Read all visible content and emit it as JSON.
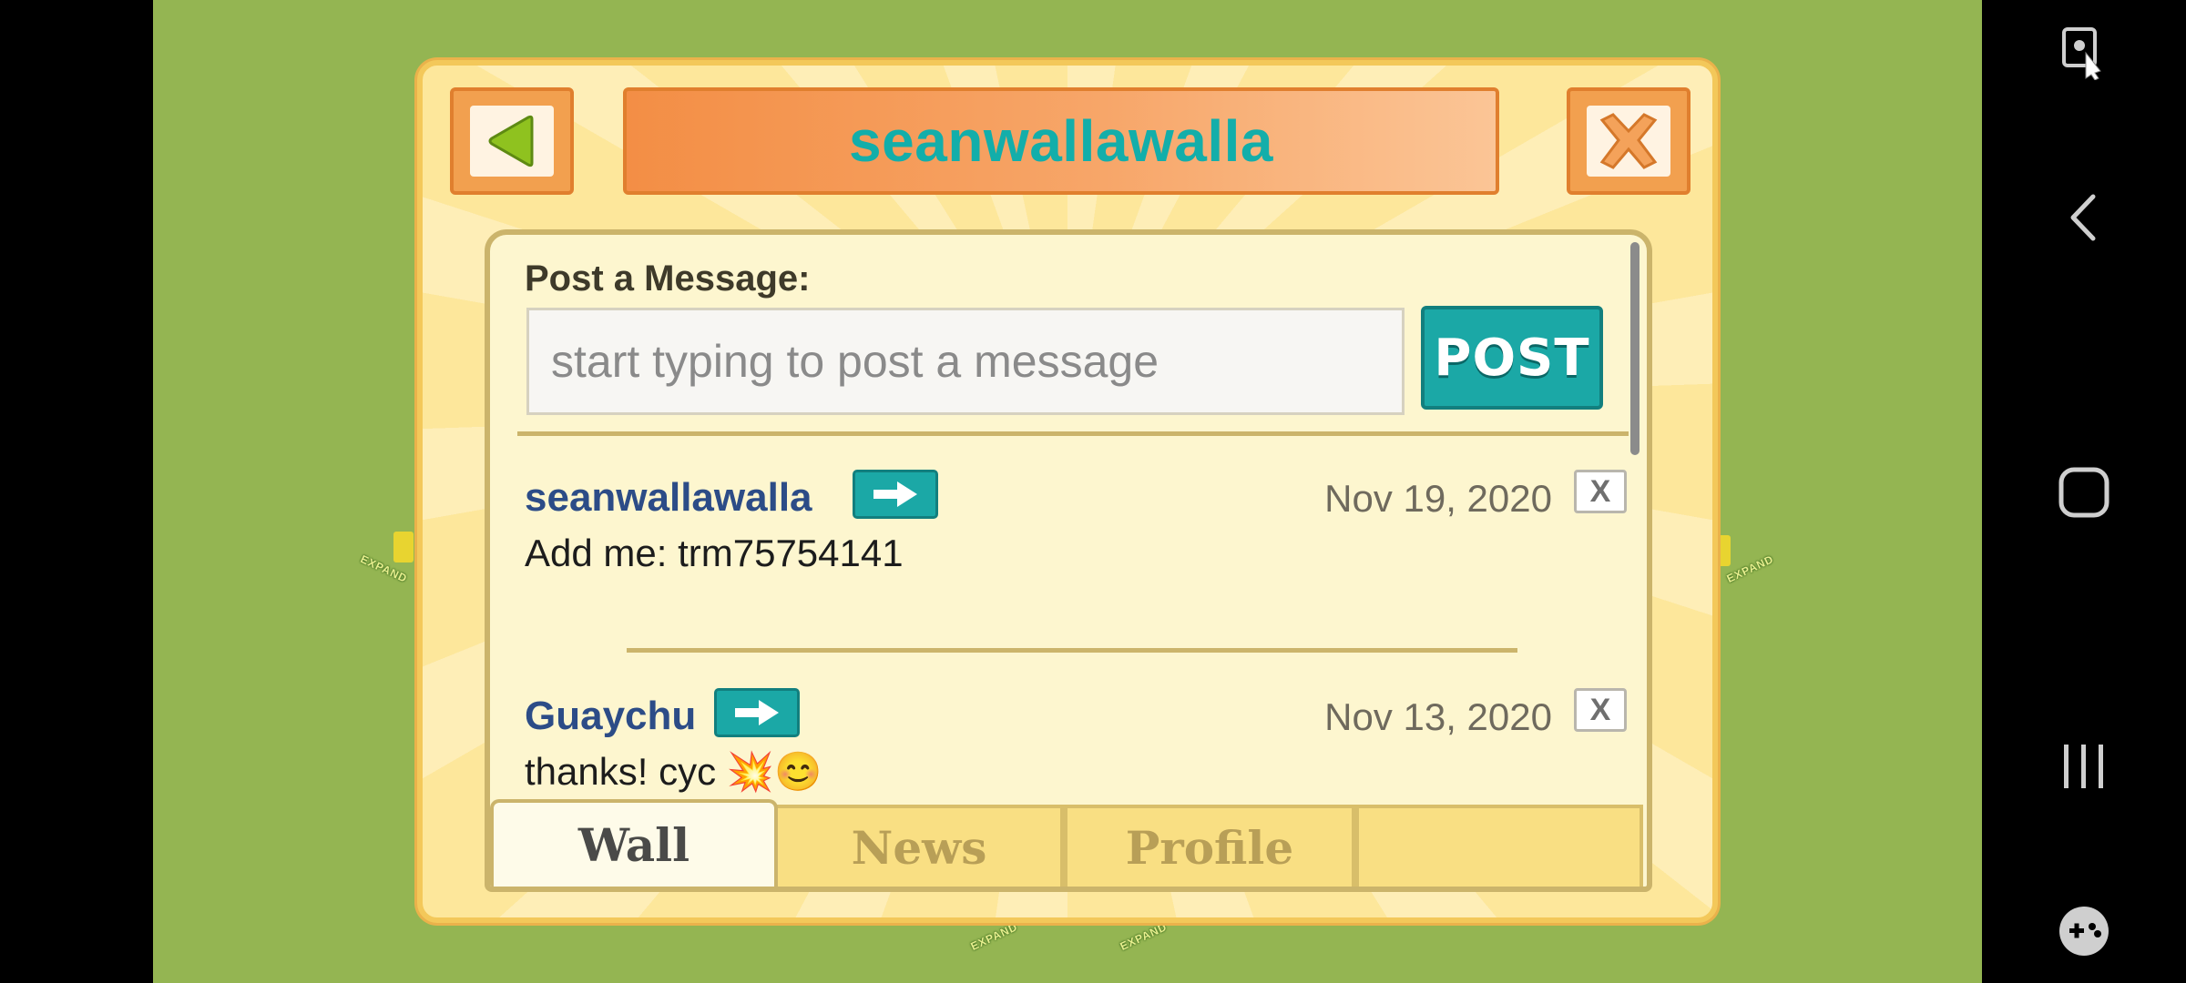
{
  "dialog": {
    "title": "seanwallawalla",
    "back_icon": "back-arrow-icon",
    "close_icon": "close-x-icon"
  },
  "composer": {
    "label": "Post a Message:",
    "placeholder": "start typing to post a message",
    "value": "",
    "post_label": "POST"
  },
  "posts": [
    {
      "author": "seanwallawalla",
      "date": "Nov 19, 2020",
      "body": "Add me: trm75754141",
      "delete_label": "X"
    },
    {
      "author": "Guaychu",
      "date": "Nov 13, 2020",
      "body": "thanks! cyc 💥😊",
      "delete_label": "X"
    }
  ],
  "tabs": [
    {
      "label": "Wall",
      "active": true
    },
    {
      "label": "News",
      "active": false
    },
    {
      "label": "Profile",
      "active": false
    },
    {
      "label": "",
      "active": false
    }
  ],
  "background": {
    "expand_label": "EXPAND"
  },
  "colors": {
    "game_green": "#94b552",
    "title_teal": "#13aeaa",
    "post_button": "#1ba8a6",
    "author_blue": "#2c4c87",
    "header_orange": "#f38e45"
  },
  "system_bar": {
    "icons": [
      "screen-pin-icon",
      "back-nav-icon",
      "home-nav-icon",
      "recents-nav-icon",
      "game-launcher-icon"
    ]
  }
}
